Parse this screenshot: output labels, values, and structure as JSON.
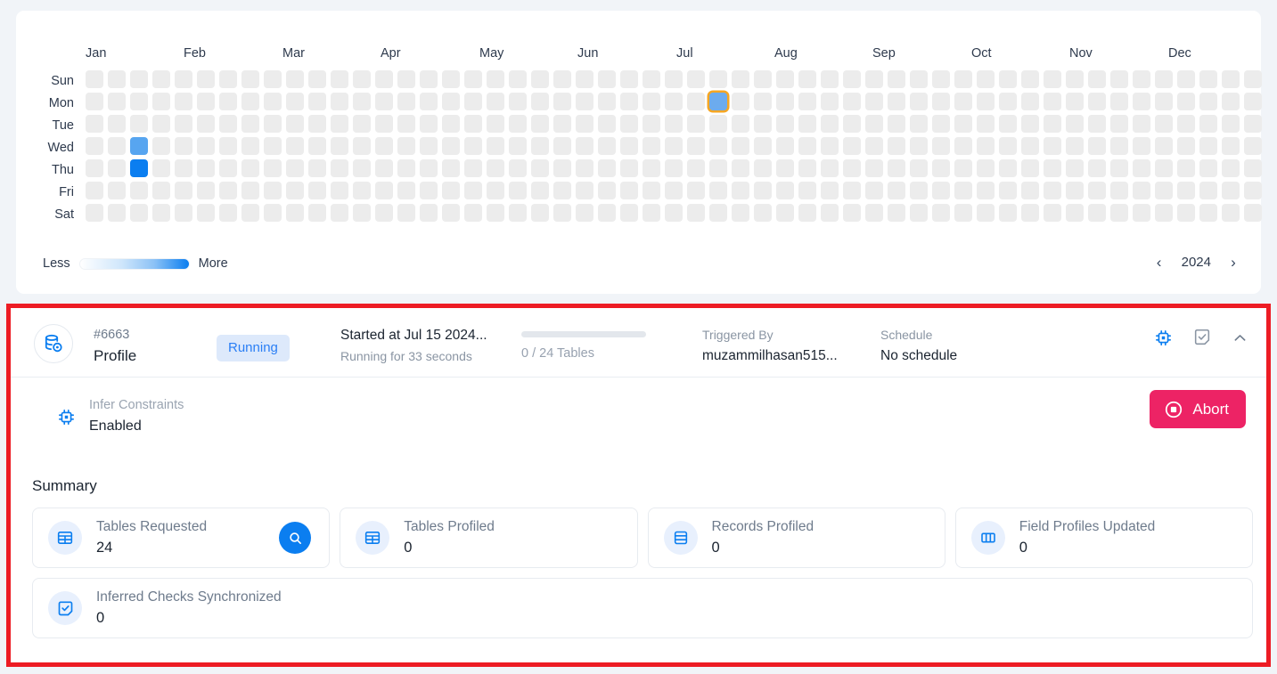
{
  "heatmap": {
    "months": [
      "Jan",
      "Feb",
      "Mar",
      "Apr",
      "May",
      "Jun",
      "Jul",
      "Aug",
      "Sep",
      "Oct",
      "Nov",
      "Dec"
    ],
    "days": [
      "Sun",
      "Mon",
      "Tue",
      "Wed",
      "Thu",
      "Fri",
      "Sat"
    ],
    "weeks": 53,
    "legend_less": "Less",
    "legend_more": "More",
    "year": "2024",
    "prev_icon": "chevron-left-icon",
    "next_icon": "chevron-right-icon",
    "active_cells": [
      {
        "day": 3,
        "week": 2,
        "level": 1
      },
      {
        "day": 4,
        "week": 2,
        "level": 2
      },
      {
        "day": 1,
        "week": 28,
        "level": 1,
        "selected": true
      }
    ],
    "colors": {
      "empty": "#ececec",
      "level1": "#57a5f0",
      "level2": "#0b7ef0",
      "selected_fill": "#6cabee",
      "selected_border": "#f5a623"
    }
  },
  "run": {
    "highlight_color": "#ed1c24",
    "icon": "database-profile-icon",
    "id": "#6663",
    "type": "Profile",
    "status": "Running",
    "status_color": "#2b7ff5",
    "started_at": "Started at Jul 15 2024...",
    "running_for": "Running for 33 seconds",
    "progress_text": "0 / 24 Tables",
    "progress_percent": 0,
    "triggered_by_label": "Triggered By",
    "triggered_by_value": "muzammilhasan515...",
    "schedule_label": "Schedule",
    "schedule_value": "No schedule",
    "actions": [
      {
        "name": "chip-settings-icon",
        "label": "Infer Constraints Settings"
      },
      {
        "name": "checklist-note-icon",
        "label": "Checks"
      },
      {
        "name": "chevron-up-icon",
        "label": "Collapse"
      }
    ],
    "infer": {
      "icon": "chip-icon",
      "label": "Infer Constraints",
      "value": "Enabled"
    },
    "abort": {
      "label": "Abort",
      "icon": "stop-circle-icon",
      "color": "#ed2365"
    },
    "summary_title": "Summary",
    "summary_cards": [
      {
        "icon": "table-grid-icon",
        "label": "Tables Requested",
        "value": "24",
        "action_icon": "search-icon"
      },
      {
        "icon": "table-grid-icon",
        "label": "Tables Profiled",
        "value": "0"
      },
      {
        "icon": "records-stack-icon",
        "label": "Records Profiled",
        "value": "0"
      },
      {
        "icon": "columns-icon",
        "label": "Field Profiles Updated",
        "value": "0"
      },
      {
        "icon": "checkbox-note-icon",
        "label": "Inferred Checks Synchronized",
        "value": "0"
      }
    ]
  }
}
